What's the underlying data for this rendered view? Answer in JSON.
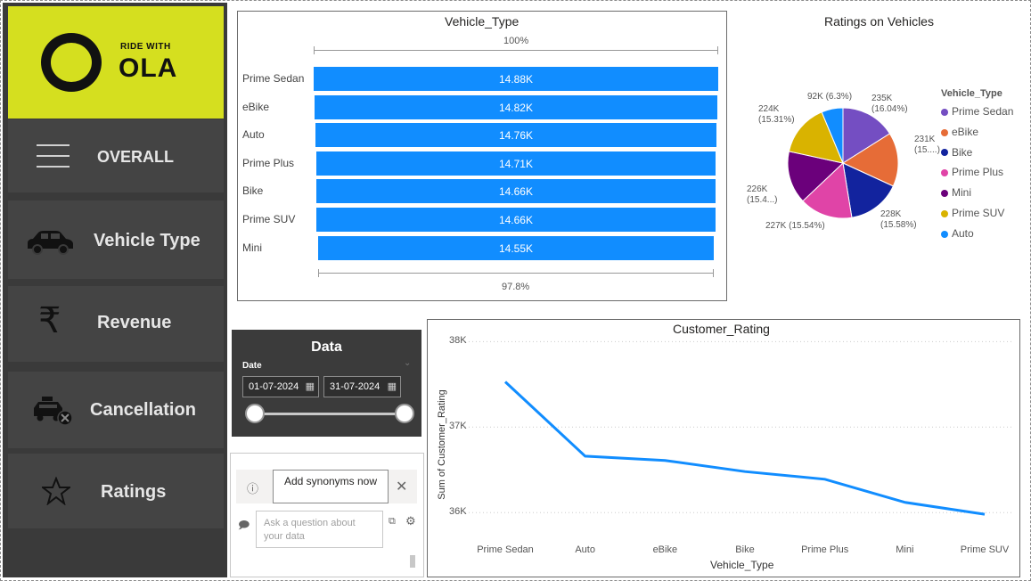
{
  "sidebar": {
    "logo_small": "RIDE WITH",
    "logo_big": "OLA",
    "items": [
      {
        "label": "OVERALL",
        "icon": "menu-icon"
      },
      {
        "label": "Vehicle Type",
        "icon": "car-icon"
      },
      {
        "label": "Revenue",
        "icon": "rupee-icon"
      },
      {
        "label": "Cancellation",
        "icon": "taxi-cancel-icon"
      },
      {
        "label": "Ratings",
        "icon": "star-icon"
      }
    ]
  },
  "vehicle_chart": {
    "title": "Vehicle_Type",
    "top_pct": "100%",
    "bottom_pct": "97.8%",
    "bars": [
      {
        "label": "Prime Sedan",
        "value_label": "14.88K"
      },
      {
        "label": "eBike",
        "value_label": "14.82K"
      },
      {
        "label": "Auto",
        "value_label": "14.76K"
      },
      {
        "label": "Prime Plus",
        "value_label": "14.71K"
      },
      {
        "label": "Bike",
        "value_label": "14.66K"
      },
      {
        "label": "Prime SUV",
        "value_label": "14.66K"
      },
      {
        "label": "Mini",
        "value_label": "14.55K"
      }
    ]
  },
  "pie": {
    "title": "Ratings on Vehicles",
    "legend_title": "Vehicle_Type",
    "slice_labels": [
      {
        "line1": "235K",
        "line2": "(16.04%)"
      },
      {
        "line1": "231K",
        "line2": "(15....)"
      },
      {
        "line1": "228K",
        "line2": "(15.58%)"
      },
      {
        "line1": "227K (15.54%)",
        "line2": ""
      },
      {
        "line1": "226K",
        "line2": "(15.4...)"
      },
      {
        "line1": "224K",
        "line2": "(15.31%)"
      },
      {
        "line1": "92K",
        "line2": "(6.3%)"
      }
    ]
  },
  "slicer": {
    "title": "Data",
    "label": "Date",
    "start_date": "01-07-2024",
    "end_date": "31-07-2024"
  },
  "qa": {
    "button_label": "Add synonyms now",
    "placeholder": "Ask a question about your data"
  },
  "line_chart": {
    "title": "Customer_Rating",
    "xlabel": "Vehicle_Type",
    "ylabel": "Sum of Customer_Rating",
    "y_ticks": [
      "38K",
      "37K",
      "36K"
    ]
  },
  "colors": {
    "accent": "#118dff",
    "sidebar_bg": "#3a3a3a",
    "logo_bg": "#d5df1f"
  },
  "chart_data": [
    {
      "type": "bar",
      "title": "Vehicle_Type",
      "categories": [
        "Prime Sedan",
        "eBike",
        "Auto",
        "Prime Plus",
        "Bike",
        "Prime SUV",
        "Mini"
      ],
      "values": [
        14880,
        14820,
        14760,
        14710,
        14660,
        14660,
        14550
      ],
      "orientation": "horizontal-funnel"
    },
    {
      "type": "pie",
      "title": "Ratings on Vehicles",
      "categories": [
        "Prime Sedan",
        "eBike",
        "Bike",
        "Prime Plus",
        "Mini",
        "Prime SUV",
        "Auto"
      ],
      "values": [
        235000,
        231000,
        228000,
        227000,
        226000,
        224000,
        92000
      ],
      "colors": [
        "#744ec2",
        "#e66c37",
        "#12239e",
        "#e044a7",
        "#6b007b",
        "#d9b300",
        "#118dff"
      ],
      "legend": "right"
    },
    {
      "type": "line",
      "title": "Customer_Rating",
      "categories": [
        "Prime Sedan",
        "Auto",
        "eBike",
        "Bike",
        "Prime Plus",
        "Mini",
        "Prime SUV"
      ],
      "values": [
        37530,
        36660,
        36610,
        36480,
        36390,
        36120,
        35980
      ],
      "xlabel": "Vehicle_Type",
      "ylabel": "Sum of Customer_Rating",
      "ylim": [
        35700,
        38150
      ],
      "y_ticks": [
        36000,
        37000,
        38000
      ],
      "grid": true
    }
  ]
}
